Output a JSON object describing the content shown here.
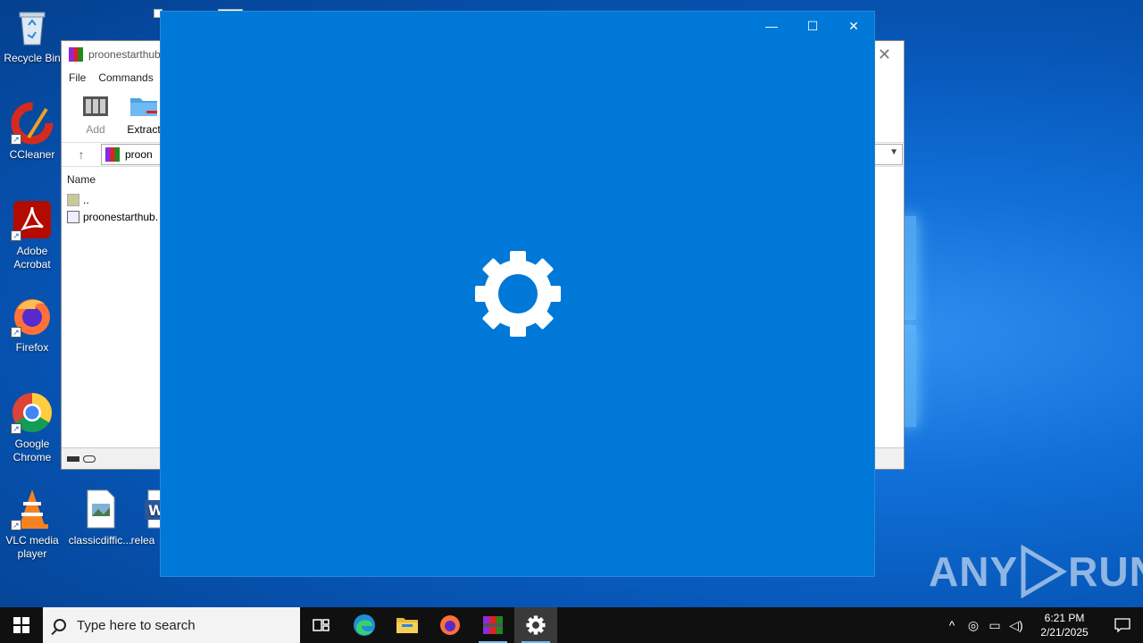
{
  "desktop_icons": [
    {
      "label": "Recycle Bin"
    },
    {
      "label": "CCleaner"
    },
    {
      "label": "Adobe Acrobat"
    },
    {
      "label": "Firefox"
    },
    {
      "label": "Google Chrome"
    },
    {
      "label": "VLC media player"
    },
    {
      "label": "classicdiffic..."
    },
    {
      "label": "relea"
    }
  ],
  "winrar": {
    "title": "proonestarthub",
    "menu": [
      "File",
      "Commands"
    ],
    "toolbar": {
      "add_label": "Add",
      "extract_label": "Extract"
    },
    "address": "proon",
    "column_name": "Name",
    "rows": [
      "..",
      "proonestarthub."
    ]
  },
  "settings_window": {
    "minimize_glyph": "—",
    "maximize_glyph": "☐",
    "close_glyph": "✕",
    "accent": "#0078d7"
  },
  "watermark": {
    "text_left": "ANY",
    "text_right": "RUN"
  },
  "taskbar": {
    "search_placeholder": "Type here to search",
    "time": "6:21 PM",
    "date": "2/21/2025"
  }
}
